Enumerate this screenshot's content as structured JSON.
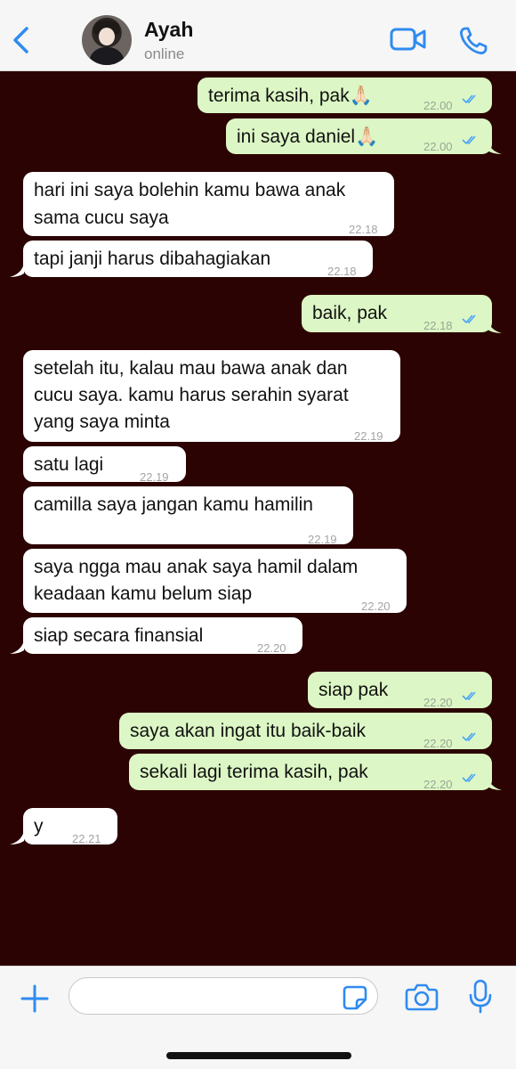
{
  "header": {
    "back_icon": "chevron-left-icon",
    "contact_name": "Ayah",
    "contact_status": "online",
    "video_icon": "video-call-icon",
    "call_icon": "phone-icon"
  },
  "colors": {
    "accent": "#2f8bf0",
    "chat_background": "#2c0303",
    "incoming_bubble": "#ffffff",
    "outgoing_bubble": "#dcf7c5",
    "read_ticks": "#4aa3f5"
  },
  "messages": [
    {
      "direction": "out",
      "text": "terima kasih, pak🙏🏻",
      "time": "22.00",
      "read": true
    },
    {
      "direction": "out",
      "text": "ini saya daniel🙏🏻",
      "time": "22.00",
      "read": true
    },
    {
      "direction": "in",
      "lines": [
        "hari ini saya bolehin kamu bawa anak",
        "sama cucu saya"
      ],
      "time": "22.18"
    },
    {
      "direction": "in",
      "text": "tapi janji harus dibahagiakan",
      "time": "22.18"
    },
    {
      "direction": "out",
      "text": "baik, pak",
      "time": "22.18",
      "read": true
    },
    {
      "direction": "in",
      "lines": [
        "setelah itu, kalau mau bawa anak dan",
        "cucu saya. kamu harus serahin syarat",
        "yang saya minta"
      ],
      "time": "22.19"
    },
    {
      "direction": "in",
      "text": "satu lagi",
      "time": "22.19"
    },
    {
      "direction": "in",
      "text": "camilla saya jangan kamu hamilin",
      "time": "22.19"
    },
    {
      "direction": "in",
      "lines": [
        "saya ngga mau anak saya hamil dalam",
        "keadaan kamu belum siap"
      ],
      "time": "22.20"
    },
    {
      "direction": "in",
      "text": "siap secara finansial",
      "time": "22.20"
    },
    {
      "direction": "out",
      "text": "siap pak",
      "time": "22.20",
      "read": true
    },
    {
      "direction": "out",
      "text": "saya akan ingat itu baik-baik",
      "time": "22.20",
      "read": true
    },
    {
      "direction": "out",
      "text": "sekali lagi terima kasih, pak",
      "time": "22.20",
      "read": true
    },
    {
      "direction": "in",
      "text": "y",
      "time": "22.21"
    }
  ],
  "input_bar": {
    "plus_icon": "plus-icon",
    "message_value": "",
    "sticker_icon": "sticker-icon",
    "camera_icon": "camera-icon",
    "mic_icon": "microphone-icon"
  }
}
